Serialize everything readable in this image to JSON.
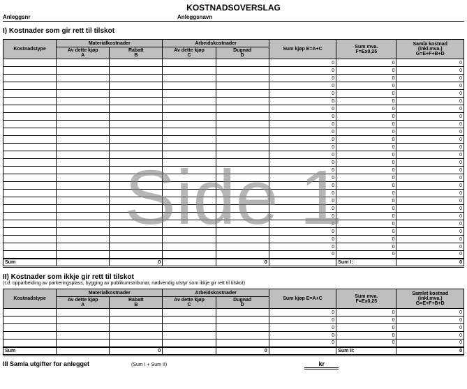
{
  "title": "KOSTNADSOVERSLAG",
  "top": {
    "anleggsnr_label": "Anleggsnr",
    "anleggsnr_value": "",
    "anleggsnavn_label": "Anleggsnavn",
    "anleggsnavn_value": ""
  },
  "watermark": "Side 1",
  "section1": {
    "heading": "I) Kostnader som gir rett til tilskot",
    "sum_label": "Sum",
    "sum_i_label": "Sum I:",
    "totals": {
      "b": "0",
      "d": "0",
      "g": "0"
    }
  },
  "section2": {
    "heading": "II) Kostnader som ikkje gir rett til tilskot",
    "note": "(t.d. opparbeiding av parkeringsplass, bygging av publikumstribunar, nødvendig utstyr som ikkje gir rett til tilskot)",
    "sum_label": "Sum",
    "sum_ii_label": "Sum II:",
    "totals": {
      "b": "0",
      "d": "0",
      "g": "0"
    }
  },
  "columns": {
    "group_mat": "Materialkostnader",
    "group_arb": "Arbeidskostnader",
    "kostnadstype": "Kostnadstype",
    "a": "Av dette kjøp\nA",
    "b": "Rabatt\nB",
    "c": "Av dette kjøp\nC",
    "d": "Dugnad\nD",
    "e": "Sum kjøp E=A+C",
    "f": "Sum mva.\nF=Ex0,25",
    "g1": "Samla kostnad\n(inkl.mva.)\nG=E+F+B+D",
    "g2": "Samlet kostnad\n(inkl.mva.)\nG=E+F+B+D"
  },
  "zeros": {
    "e": "0",
    "f": "0",
    "g": "0"
  },
  "footer": {
    "heading": "III Samla utgifter for anlegget",
    "sub": "(Sum I + Sum II)",
    "kr": "kr"
  },
  "chart_data": {
    "type": "table",
    "title": "KOSTNADSOVERSLAG",
    "tables": [
      {
        "name": "I) Kostnader som gir rett til tilskot",
        "columns": [
          "Kostnadstype",
          "Av dette kjøp A",
          "Rabatt B",
          "Av dette kjøp C",
          "Dugnad D",
          "Sum kjøp E=A+C",
          "Sum mva. F=Ex0,25",
          "Samla kostnad (inkl.mva.) G=E+F+B+D"
        ],
        "rows": 26,
        "row_defaults": {
          "E": 0,
          "F": 0,
          "G": 0
        },
        "totals": {
          "B": 0,
          "D": 0,
          "Sum I": 0
        }
      },
      {
        "name": "II) Kostnader som ikkje gir rett til tilskot",
        "columns": [
          "Kostnadstype",
          "Av dette kjøp A",
          "Rabatt B",
          "Av dette kjøp C",
          "Dugnad D",
          "Sum kjøp E=A+C",
          "Sum mva. F=Ex0,25",
          "Samlet kostnad (inkl.mva.) G=E+F+B+D"
        ],
        "rows": 5,
        "row_defaults": {
          "E": 0,
          "F": 0,
          "G": 0
        },
        "totals": {
          "B": 0,
          "D": 0,
          "Sum II": 0
        }
      }
    ]
  }
}
